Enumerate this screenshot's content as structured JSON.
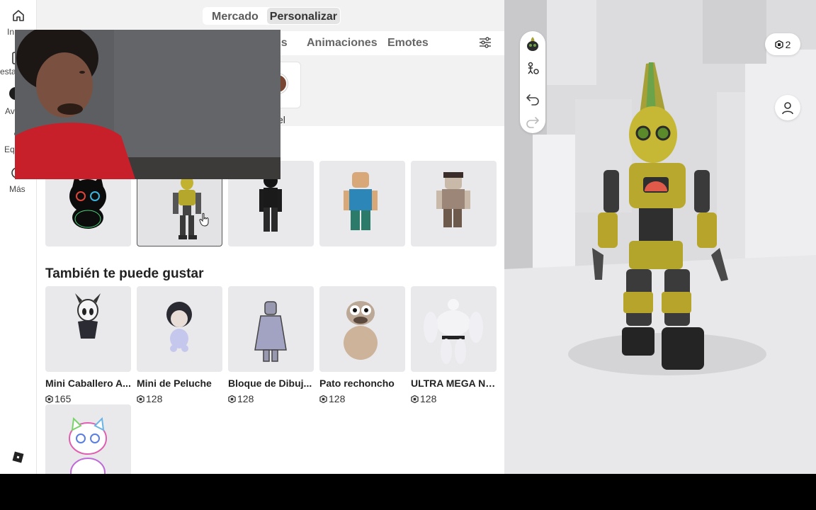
{
  "nav": {
    "items": [
      {
        "label": "In",
        "icon": "home-icon"
      },
      {
        "label": "",
        "icon": "document-icon"
      },
      {
        "label": "esta",
        "icon": ""
      },
      {
        "label": "Av",
        "icon": "avatar-icon"
      },
      {
        "label": "Eq",
        "icon": "groups-icon"
      },
      {
        "label": "Más",
        "icon": "more-icon"
      }
    ]
  },
  "header": {
    "segments": [
      "Mercado",
      "Personalizar"
    ],
    "active_segment": "Personalizar"
  },
  "tabs": [
    {
      "label": "os"
    },
    {
      "label": "Animaciones"
    },
    {
      "label": "Emotes"
    }
  ],
  "subcategory": {
    "label": "el",
    "swatch_color": "#7a4634"
  },
  "recommend": {
    "title": "También te puede gustar",
    "items": [
      {
        "name": "Mini Caballero A...",
        "price": "165"
      },
      {
        "name": "Mini de Peluche",
        "price": "128"
      },
      {
        "name": "Bloque de Dibuj...",
        "price": "128"
      },
      {
        "name": "Pato rechoncho",
        "price": "128"
      },
      {
        "name": "ULTRA MEGA NO...",
        "price": "128"
      }
    ]
  },
  "preview": {
    "robux_count": "2"
  },
  "colors": {
    "panel_bg": "#f2f2f2",
    "card_bg": "#e9e9ec",
    "robot_gold": "#b7a42a"
  }
}
